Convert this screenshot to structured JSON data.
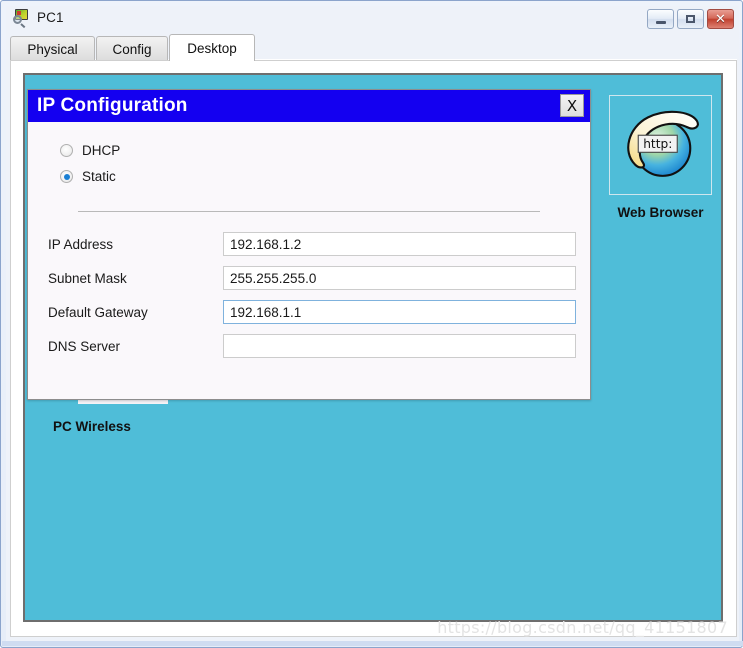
{
  "window": {
    "title": "PC1",
    "icon": "pc-magnifier-icon",
    "controls": {
      "minimize": "–",
      "maximize": "□",
      "close": "✕"
    }
  },
  "tabs": [
    {
      "label": "Physical",
      "active": false
    },
    {
      "label": "Config",
      "active": false
    },
    {
      "label": "Desktop",
      "active": true
    }
  ],
  "desktop": {
    "background_color": "#4fbdd8",
    "shortcuts": [
      {
        "label": "Web Browser",
        "icon": "ie-globe-icon",
        "icon_text": "http:",
        "selected": true
      },
      {
        "label": "PC Wireless",
        "icon": "pc-wireless-icon",
        "selected": false
      }
    ]
  },
  "dialog": {
    "title": "IP Configuration",
    "title_bar_color": "#1400f0",
    "close_label": "X",
    "mode": {
      "options": [
        {
          "label": "DHCP",
          "selected": false
        },
        {
          "label": "Static",
          "selected": true
        }
      ]
    },
    "fields": [
      {
        "label": "IP Address",
        "value": "192.168.1.2",
        "placeholder": "",
        "focused": false
      },
      {
        "label": "Subnet Mask",
        "value": "255.255.255.0",
        "placeholder": "",
        "focused": false
      },
      {
        "label": "Default Gateway",
        "value": "192.168.1.1",
        "placeholder": "",
        "focused": true
      },
      {
        "label": "DNS Server",
        "value": "",
        "placeholder": "",
        "focused": false
      }
    ]
  },
  "watermark": "https://blog.csdn.net/qq_41151807"
}
